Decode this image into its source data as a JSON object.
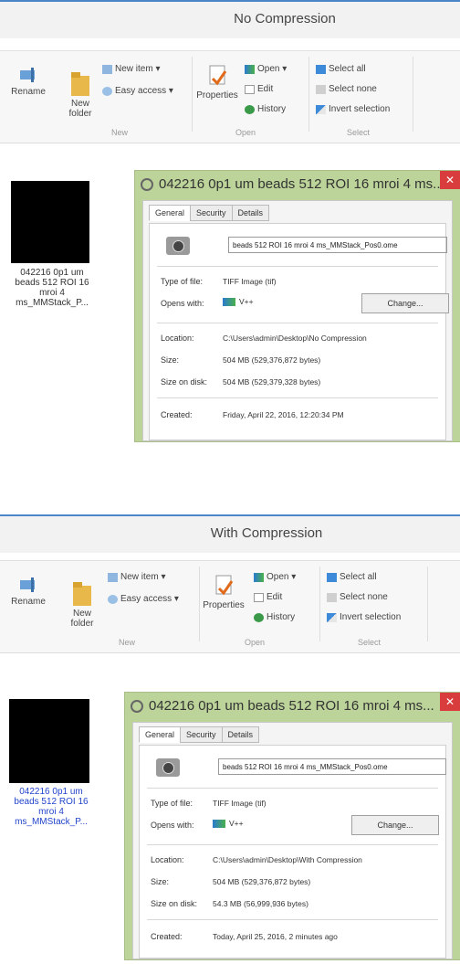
{
  "panels": [
    {
      "window_title": "No Compression",
      "ribbon": {
        "rename": "Rename",
        "new_folder": "New\nfolder",
        "new_item": "New item ▾",
        "easy_access": "Easy access ▾",
        "new_group": "New",
        "properties": "Properties",
        "open": "Open ▾",
        "edit": "Edit",
        "history": "History",
        "open_group": "Open",
        "select_all": "Select all",
        "select_none": "Select none",
        "invert_selection": "Invert selection",
        "select_group": "Select"
      },
      "file_thumb_label": "042216 0p1 um\nbeads 512 ROI 16\nmroi 4\nms_MMStack_P...",
      "dialog": {
        "title": "042216 0p1 um beads 512 ROI 16 mroi 4 ms...",
        "close": "✕",
        "tabs": [
          "General",
          "Security",
          "Details"
        ],
        "file_name": "beads 512 ROI 16 mroi 4 ms_MMStack_Pos0.ome",
        "type_label": "Type of file:",
        "type_value": "TIFF Image (tif)",
        "opens_label": "Opens with:",
        "opens_value": "V++",
        "change_button": "Change...",
        "location_label": "Location:",
        "location_value": "C:\\Users\\admin\\Desktop\\No Compression",
        "size_label": "Size:",
        "size_value": "504 MB (529,376,872 bytes)",
        "size_disk_label": "Size on disk:",
        "size_disk_value": "504 MB (529,379,328 bytes)",
        "created_label": "Created:",
        "created_value": "Friday, April 22, 2016, 12:20:34 PM"
      }
    },
    {
      "window_title": "With Compression",
      "ribbon": {
        "rename": "Rename",
        "new_folder": "New\nfolder",
        "new_item": "New item ▾",
        "easy_access": "Easy access ▾",
        "new_group": "New",
        "properties": "Properties",
        "open": "Open ▾",
        "edit": "Edit",
        "history": "History",
        "open_group": "Open",
        "select_all": "Select all",
        "select_none": "Select none",
        "invert_selection": "Invert selection",
        "select_group": "Select"
      },
      "file_thumb_label": "042216 0p1 um\nbeads 512 ROI 16\nmroi 4\nms_MMStack_P...",
      "dialog": {
        "title": "042216 0p1 um beads 512 ROI 16 mroi 4 ms...",
        "close": "✕",
        "tabs": [
          "General",
          "Security",
          "Details"
        ],
        "file_name": "beads 512 ROI 16 mroi 4 ms_MMStack_Pos0.ome",
        "type_label": "Type of file:",
        "type_value": "TIFF Image (tif)",
        "opens_label": "Opens with:",
        "opens_value": "V++",
        "change_button": "Change...",
        "location_label": "Location:",
        "location_value": "C:\\Users\\admin\\Desktop\\With Compression",
        "size_label": "Size:",
        "size_value": "504 MB (529,376,872 bytes)",
        "size_disk_label": "Size on disk:",
        "size_disk_value": "54.3 MB (56,999,936 bytes)",
        "created_label": "Created:",
        "created_value": "Today, April 25, 2016, 2 minutes ago"
      }
    }
  ]
}
